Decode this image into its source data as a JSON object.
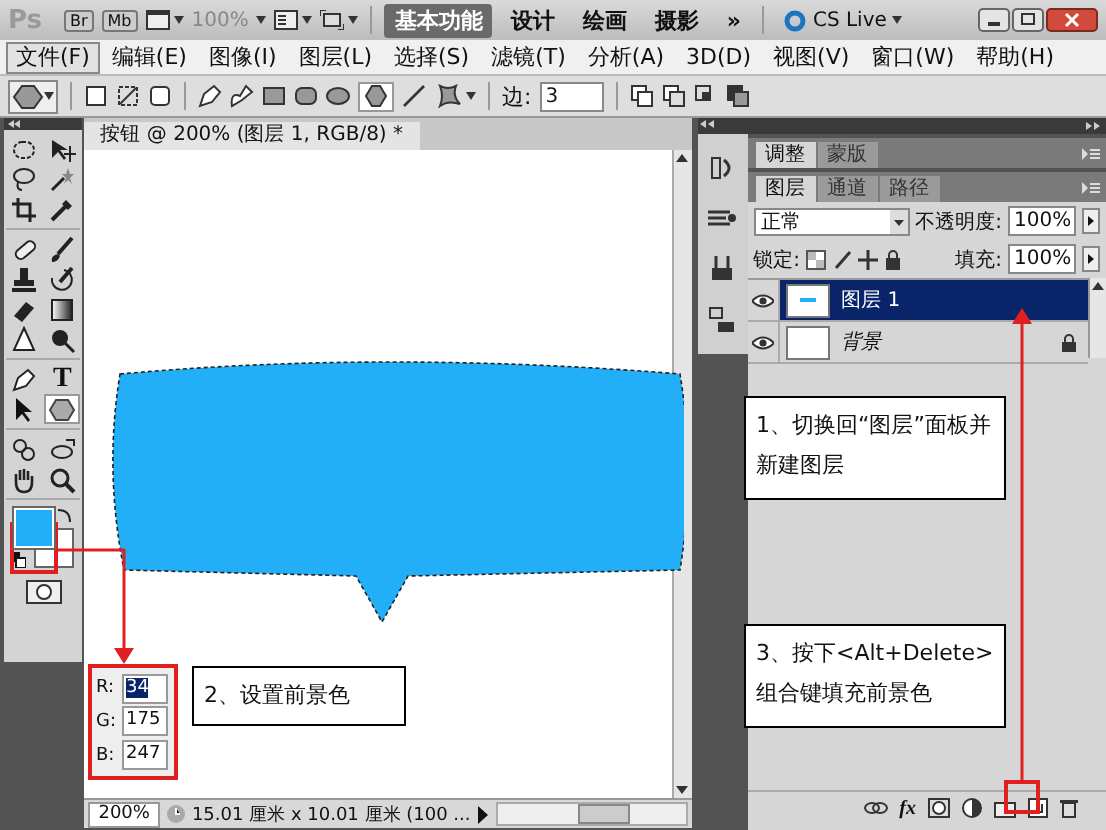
{
  "app_bar": {
    "logo": "Ps",
    "bridge": "Br",
    "mini_bridge": "Mb",
    "zoom": "100%",
    "more": "»",
    "cs_live": "CS Live",
    "workspaces": [
      {
        "label": "基本功能",
        "selected": true
      },
      {
        "label": "设计",
        "selected": false
      },
      {
        "label": "绘画",
        "selected": false
      },
      {
        "label": "摄影",
        "selected": false
      }
    ]
  },
  "menu": [
    {
      "label": "文件(F)",
      "selected": true
    },
    {
      "label": "编辑(E)",
      "selected": false
    },
    {
      "label": "图像(I)",
      "selected": false
    },
    {
      "label": "图层(L)",
      "selected": false
    },
    {
      "label": "选择(S)",
      "selected": false
    },
    {
      "label": "滤镜(T)",
      "selected": false
    },
    {
      "label": "分析(A)",
      "selected": false
    },
    {
      "label": "3D(D)",
      "selected": false
    },
    {
      "label": "视图(V)",
      "selected": false
    },
    {
      "label": "窗口(W)",
      "selected": false
    },
    {
      "label": "帮助(H)",
      "selected": false
    }
  ],
  "options_bar": {
    "sides_label": "边:",
    "sides_value": "3"
  },
  "toolbox": {
    "type_tool": "T"
  },
  "document": {
    "title": "按钮 @ 200% (图层 1, RGB/8) *",
    "zoom": "200%",
    "info": "15.01 厘米 x 10.01 厘米 (100 ..."
  },
  "color_readout": [
    {
      "label": "R:",
      "value": "34",
      "selected": true
    },
    {
      "label": "G:",
      "value": "175",
      "selected": false
    },
    {
      "label": "B:",
      "value": "247",
      "selected": false
    }
  ],
  "panels": {
    "top_tabs": [
      {
        "label": "调整",
        "selected": true
      },
      {
        "label": "蒙版",
        "selected": false
      }
    ],
    "layer_tabs": [
      {
        "label": "图层",
        "selected": true
      },
      {
        "label": "通道",
        "selected": false
      },
      {
        "label": "路径",
        "selected": false
      }
    ],
    "blend_mode": "正常",
    "opacity_label": "不透明度:",
    "opacity": "100%",
    "lock_label": "锁定:",
    "fill_label": "填充:",
    "fill": "100%",
    "fx": "fx",
    "layers": [
      {
        "name": "图层 1",
        "selected": true,
        "visible": true,
        "locked": false
      },
      {
        "name": "背景",
        "selected": false,
        "visible": true,
        "locked": true
      }
    ]
  },
  "annotations": [
    {
      "text": "1、切换回“图层”面板并新建图层"
    },
    {
      "text": "2、设置前景色"
    },
    {
      "text": "3、按下<Alt+Delete>组合键填充前景色"
    }
  ]
}
